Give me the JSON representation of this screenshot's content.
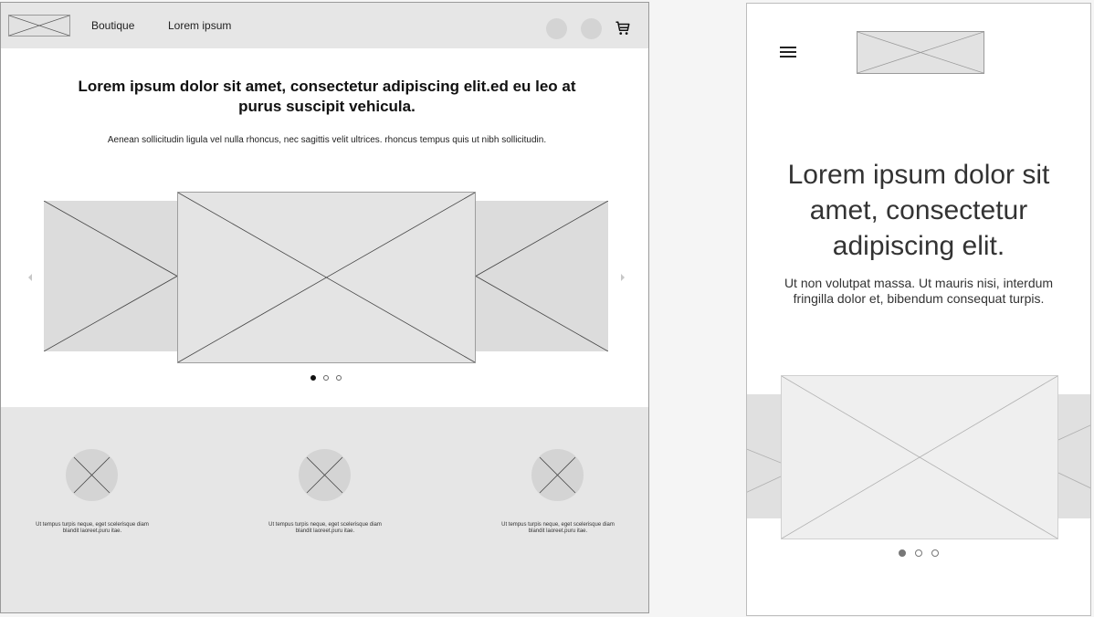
{
  "desktop": {
    "nav": {
      "links": [
        "Boutique",
        "Lorem ipsum"
      ],
      "account_icons": [
        "user-circle-icon",
        "user-circle-icon"
      ],
      "cart_icon": "shopping-cart-icon"
    },
    "hero": {
      "title": "Lorem ipsum dolor sit amet, consectetur adipiscing elit.ed eu leo at purus suscipit vehicula.",
      "text": "Aenean sollicitudin ligula vel nulla rhoncus, nec sagittis velit ultrices. rhoncus tempus quis ut nibh sollicitudin."
    },
    "carousel": {
      "slide_count": 3,
      "active_index": 0
    },
    "features": [
      {
        "text": "Ut tempus turpis neque, eget scelerisque diam blandit laoreet.puru itae."
      },
      {
        "text": "Ut tempus turpis neque, eget scelerisque diam blandit laoreet.puru itae."
      },
      {
        "text": "Ut tempus turpis neque, eget scelerisque diam blandit laoreet.puru itae."
      }
    ]
  },
  "mobile": {
    "menu_icon": "hamburger-menu-icon",
    "hero": {
      "title": "Lorem ipsum dolor sit amet, consectetur adipiscing elit.",
      "text": "Ut non volutpat massa. Ut mauris nisi, interdum fringilla dolor et, bibendum consequat turpis."
    },
    "carousel": {
      "slide_count": 3,
      "active_index": 0
    }
  },
  "colors": {
    "placeholder": "#dcdcdc",
    "band": "#e6e6e6",
    "line": "#555555",
    "mobile_line": "#b0b0b0"
  }
}
